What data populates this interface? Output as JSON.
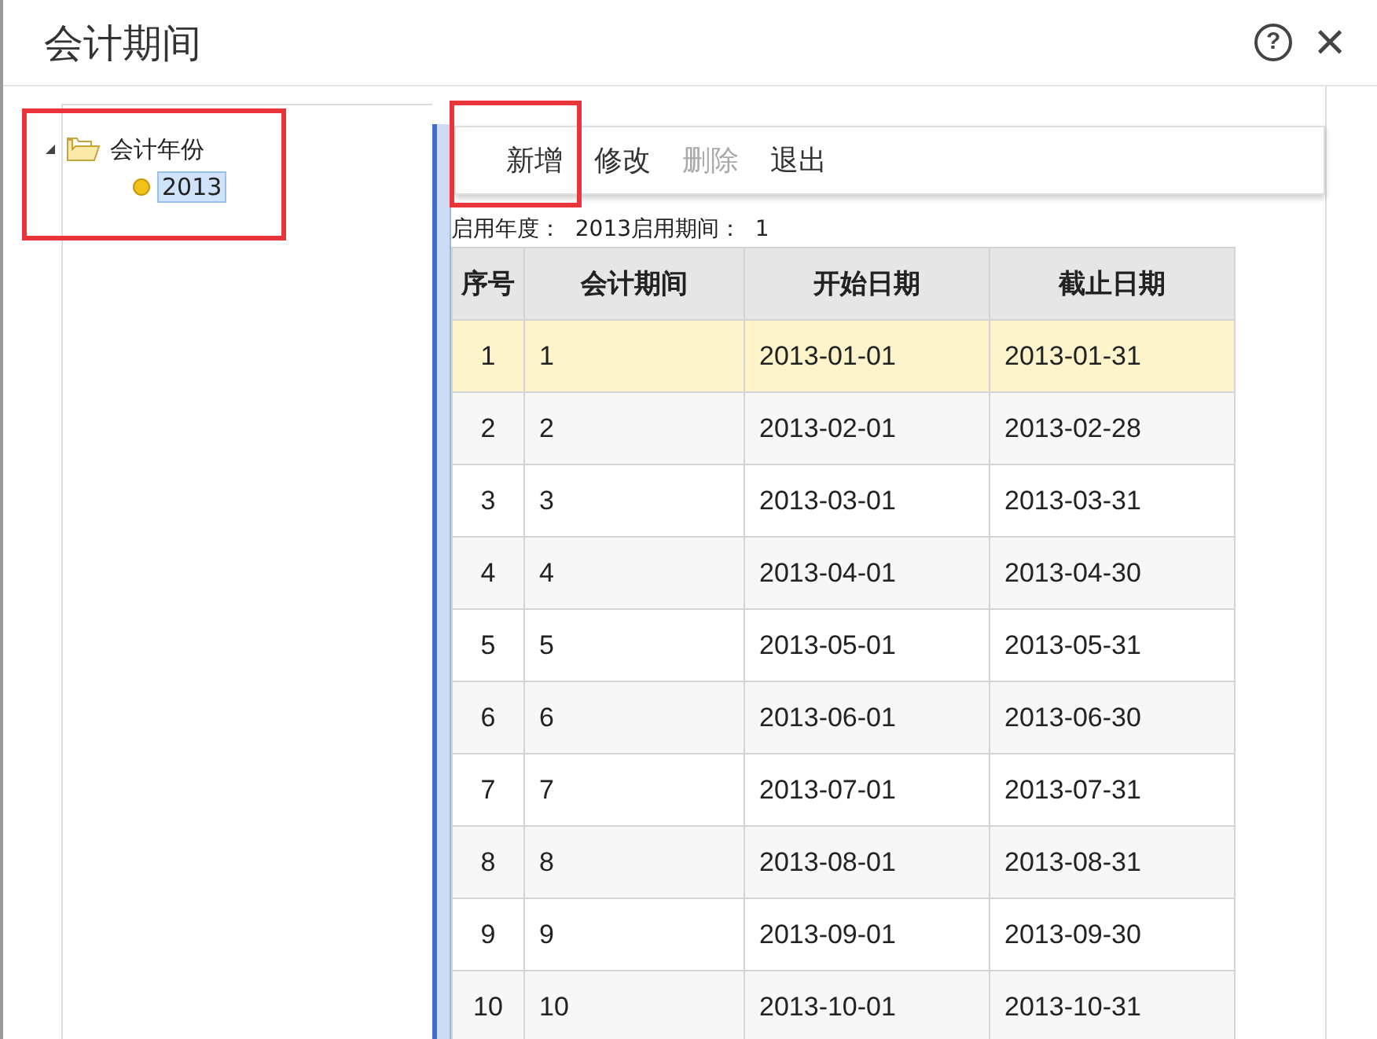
{
  "window": {
    "title": "会计期间",
    "buttons": [
      {
        "kind": "help",
        "label": "?"
      },
      {
        "kind": "close",
        "label": "×"
      }
    ]
  },
  "tree": {
    "highlighted": true,
    "items": [
      {
        "label": "会计年份",
        "expanded": true,
        "children": [
          {
            "label": "2013",
            "selected": true
          }
        ]
      }
    ]
  },
  "toolbar": [
    {
      "label": "新增",
      "disabled": false,
      "highlighted": true
    },
    {
      "label": "修改",
      "disabled": false,
      "highlighted": false
    },
    {
      "label": "删除",
      "disabled": true,
      "highlighted": false
    },
    {
      "label": "退出",
      "disabled": false,
      "highlighted": false
    }
  ],
  "info": [
    {
      "label": "启用年度：",
      "value": "2013"
    },
    {
      "label": "启用期间：",
      "value": "1"
    }
  ],
  "table": {
    "columns": [
      "序号",
      "会计期间",
      "开始日期",
      "截止日期"
    ],
    "rows": [
      {
        "selected": true,
        "cells": [
          "1",
          "1",
          "2013-01-01",
          "2013-01-31"
        ]
      },
      {
        "selected": false,
        "cells": [
          "2",
          "2",
          "2013-02-01",
          "2013-02-28"
        ]
      },
      {
        "selected": false,
        "cells": [
          "3",
          "3",
          "2013-03-01",
          "2013-03-31"
        ]
      },
      {
        "selected": false,
        "cells": [
          "4",
          "4",
          "2013-04-01",
          "2013-04-30"
        ]
      },
      {
        "selected": false,
        "cells": [
          "5",
          "5",
          "2013-05-01",
          "2013-05-31"
        ]
      },
      {
        "selected": false,
        "cells": [
          "6",
          "6",
          "2013-06-01",
          "2013-06-30"
        ]
      },
      {
        "selected": false,
        "cells": [
          "7",
          "7",
          "2013-07-01",
          "2013-07-31"
        ]
      },
      {
        "selected": false,
        "cells": [
          "8",
          "8",
          "2013-08-01",
          "2013-08-31"
        ]
      },
      {
        "selected": false,
        "cells": [
          "9",
          "9",
          "2013-09-01",
          "2013-09-30"
        ]
      },
      {
        "selected": false,
        "cells": [
          "10",
          "10",
          "2013-10-01",
          "2013-10-31"
        ]
      }
    ]
  }
}
